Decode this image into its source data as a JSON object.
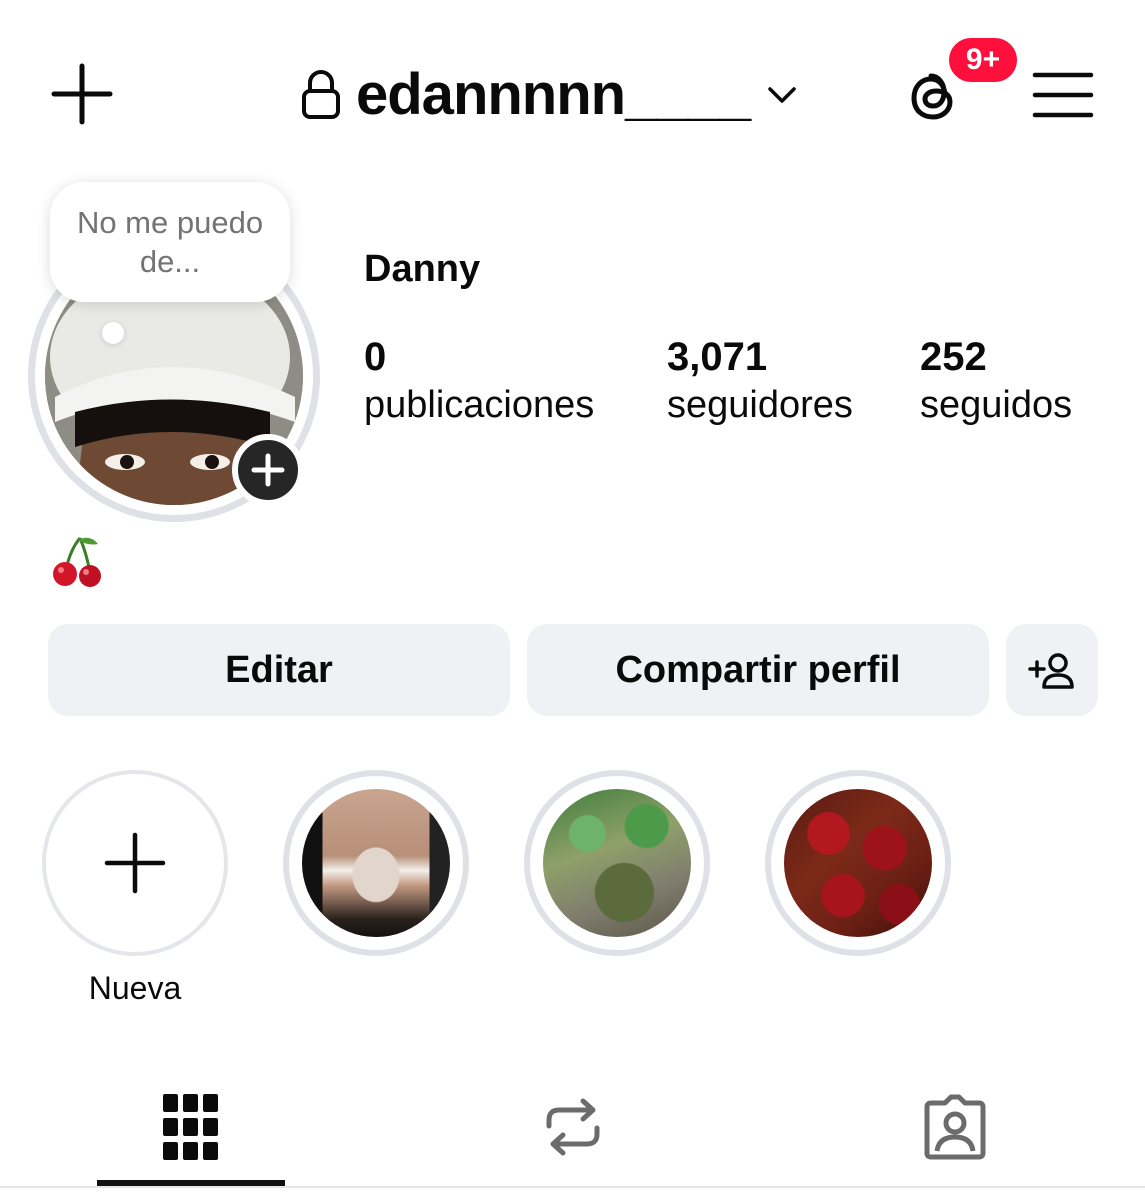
{
  "topbar": {
    "username": "edannnnn____",
    "notification_badge": "9+",
    "icons": [
      "plus-icon",
      "lock-icon",
      "chevron-down-icon",
      "threads-icon",
      "hamburger-menu-icon"
    ],
    "badge_color": "#ff0f3c"
  },
  "profile": {
    "note": "No me puedo de...",
    "display_name": "Danny",
    "bio": "🍒",
    "stats": [
      {
        "value": "0",
        "label": "publicaciones"
      },
      {
        "value": "3,071",
        "label": "seguidores"
      },
      {
        "value": "252",
        "label": "seguidos"
      }
    ]
  },
  "actions": {
    "edit_label": "Editar",
    "share_label": "Compartir perfil",
    "discover_icon": "add-person-icon"
  },
  "highlights": {
    "new_label": "Nueva",
    "items": [
      {
        "label": "",
        "image": "mirror-photo"
      },
      {
        "label": "",
        "image": "turtle-plants-photo"
      },
      {
        "label": "",
        "image": "red-roses-photo"
      }
    ]
  },
  "tabs": [
    {
      "name": "posts-grid",
      "icon": "grid-icon",
      "active": true
    },
    {
      "name": "reposts",
      "icon": "repost-icon",
      "active": false
    },
    {
      "name": "tagged",
      "icon": "tagged-person-icon",
      "active": false
    }
  ],
  "colors": {
    "button_bg": "#eff1f4",
    "ring": "#dfe1e6",
    "text": "#0a0a0a",
    "muted": "#737373"
  }
}
